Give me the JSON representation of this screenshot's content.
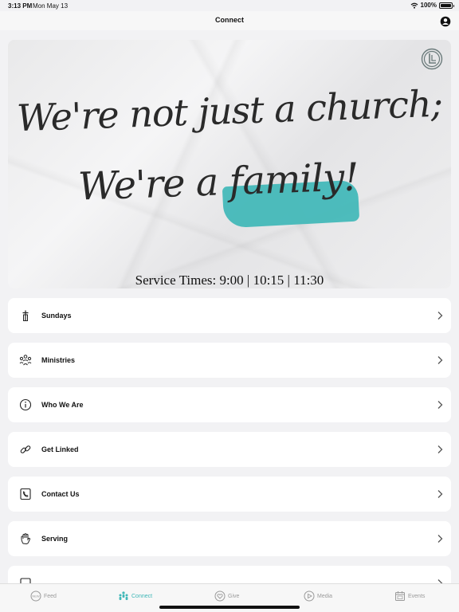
{
  "status_bar": {
    "time": "3:13 PM",
    "date": "Mon May 13",
    "battery": "100%"
  },
  "nav": {
    "title": "Connect"
  },
  "hero": {
    "line1": "We're not just a church;",
    "line2_prefix": "We're a ",
    "line2_highlight": "family",
    "line2_suffix": "!",
    "service_times": "Service Times:  9:00 | 10:15 | 11:30",
    "accent_color": "#3fb7b7"
  },
  "menu": {
    "items": [
      {
        "label": "Sundays",
        "icon": "cross-icon"
      },
      {
        "label": "Ministries",
        "icon": "people-icon"
      },
      {
        "label": "Who We Are",
        "icon": "info-icon"
      },
      {
        "label": "Get Linked",
        "icon": "link-icon"
      },
      {
        "label": "Contact Us",
        "icon": "phone-icon"
      },
      {
        "label": "Serving",
        "icon": "hand-icon"
      },
      {
        "label": "",
        "icon": "document-icon"
      }
    ]
  },
  "tabs": [
    {
      "label": "Feed",
      "icon": "new-badge-icon",
      "active": false
    },
    {
      "label": "Connect",
      "icon": "connect-people-icon",
      "active": true
    },
    {
      "label": "Give",
      "icon": "heart-icon",
      "active": false
    },
    {
      "label": "Media",
      "icon": "play-icon",
      "active": false
    },
    {
      "label": "Events",
      "icon": "calendar-icon",
      "active": false
    }
  ],
  "colors": {
    "accent": "#3fb7b7",
    "inactive": "#9a9a9a"
  }
}
